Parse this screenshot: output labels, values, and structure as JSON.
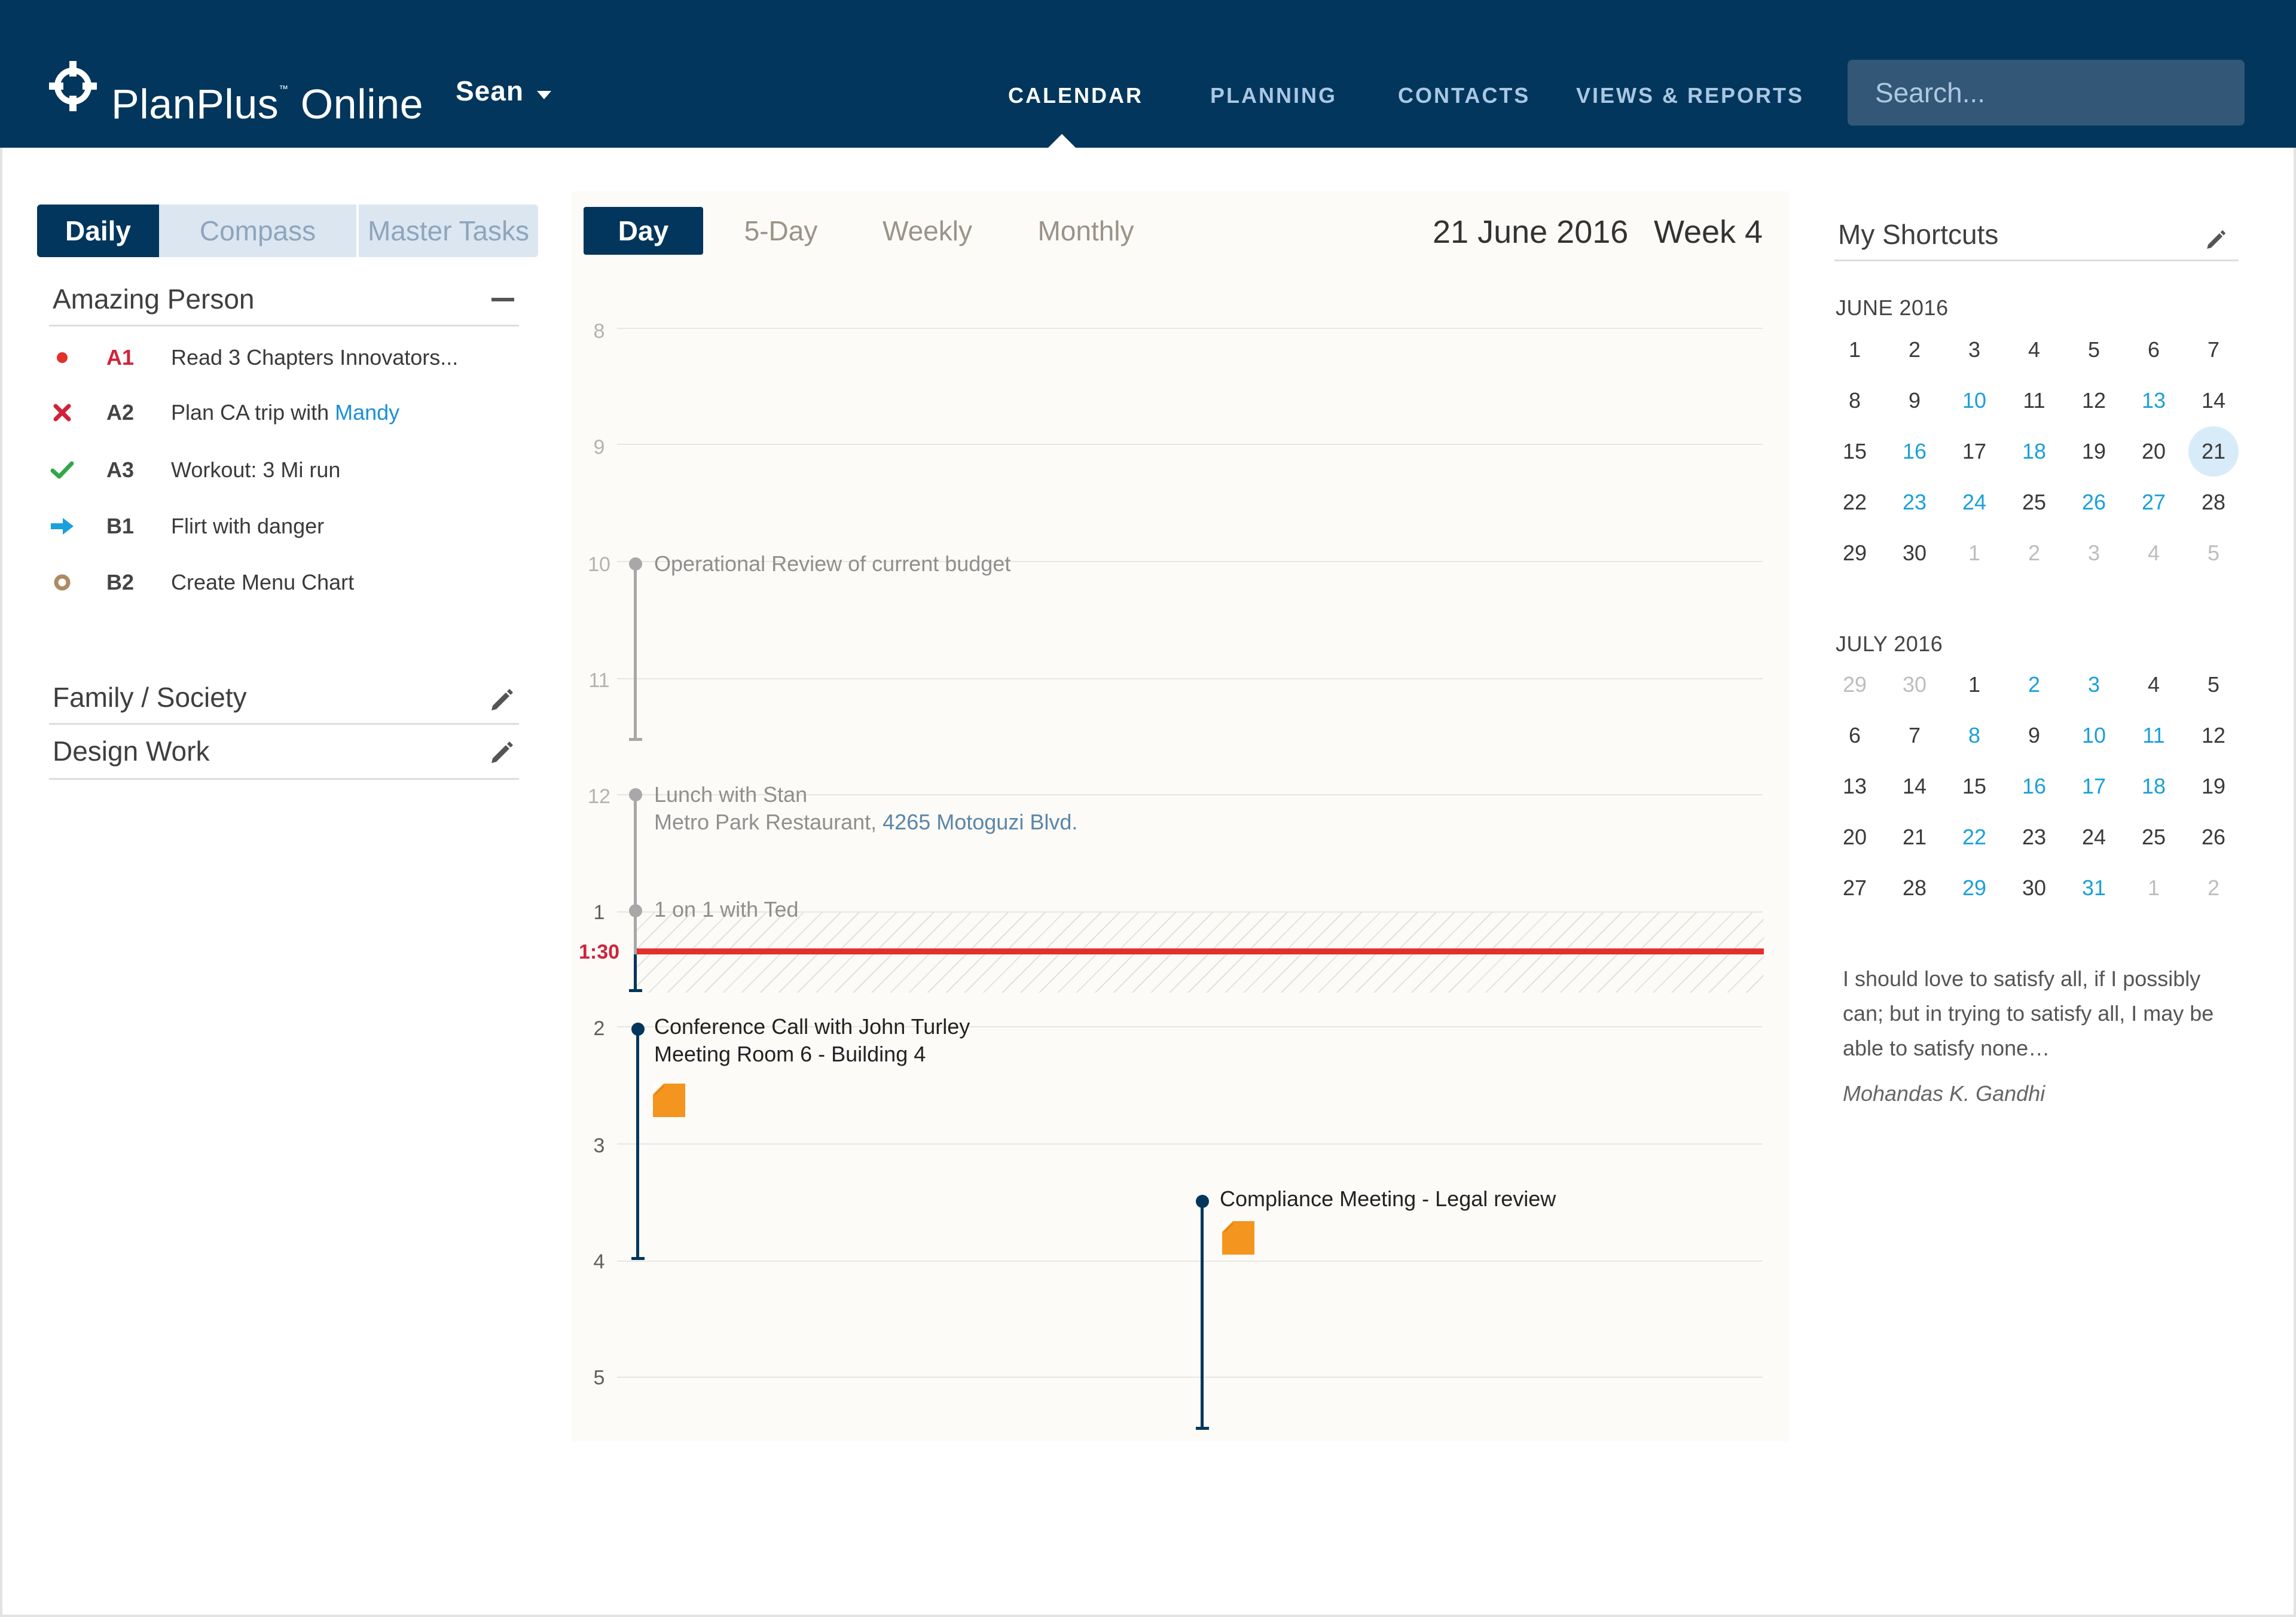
{
  "header": {
    "brand": "PlanPlus",
    "brand_tm": "™",
    "brand_suffix": "Online",
    "user": "Sean",
    "nav": {
      "calendar": "CALENDAR",
      "planning": "PLANNING",
      "contacts": "CONTACTS",
      "views_reports": "VIEWS & REPORTS"
    },
    "search_placeholder": "Search..."
  },
  "left_tabs": {
    "daily": "Daily",
    "compass": "Compass",
    "master_tasks": "Master Tasks"
  },
  "roles": {
    "amazing_person": "Amazing Person",
    "family_society": "Family / Society",
    "design_work": "Design Work"
  },
  "tasks": [
    {
      "status_icon": "red-dot-icon",
      "priority": "A1",
      "text": "Read 3 Chapters Innovators..."
    },
    {
      "status_icon": "x-mark-icon",
      "priority": "A2",
      "text": "Plan CA trip with ",
      "link": "Mandy"
    },
    {
      "status_icon": "checkmark-icon",
      "priority": "A3",
      "text": "Workout: 3 Mi run"
    },
    {
      "status_icon": "arrow-right-icon",
      "priority": "B1",
      "text": "Flirt with danger"
    },
    {
      "status_icon": "circle-icon",
      "priority": "B2",
      "text": "Create Menu Chart"
    }
  ],
  "calendar": {
    "tabs": {
      "day": "Day",
      "five_day": "5-Day",
      "weekly": "Weekly",
      "monthly": "Monthly"
    },
    "date": "21 June 2016",
    "week": "Week 4",
    "hours": {
      "h8": "8",
      "h9": "9",
      "h10": "10",
      "h11": "11",
      "h12": "12",
      "h1": "1",
      "h2": "2",
      "h3": "3",
      "h4": "4",
      "h5": "5"
    },
    "now": "1:30",
    "events": {
      "operational_review": "Operational Review of current budget",
      "lunch_title": "Lunch with Stan",
      "lunch_location_prefix": "Metro Park Restaurant, ",
      "lunch_address": "4265 Motoguzi Blvd.",
      "one_on_one": "1 on 1 with Ted",
      "conference_title": "Conference Call with John Turley",
      "conference_location": "Meeting Room 6 - Building 4",
      "compliance": "Compliance Meeting - Legal review"
    },
    "colors": {
      "past_event": "#a8a8a8",
      "upcoming_event": "#02365c",
      "now_line": "#e2312b",
      "note": "#f3951f"
    }
  },
  "shortcuts": {
    "title": "My Shortcuts",
    "june": {
      "label": "JUNE 2016",
      "days": [
        {
          "d": "1"
        },
        {
          "d": "2"
        },
        {
          "d": "3"
        },
        {
          "d": "4"
        },
        {
          "d": "5"
        },
        {
          "d": "6"
        },
        {
          "d": "7"
        },
        {
          "d": "8"
        },
        {
          "d": "9"
        },
        {
          "d": "10",
          "s": "link"
        },
        {
          "d": "11"
        },
        {
          "d": "12"
        },
        {
          "d": "13",
          "s": "link"
        },
        {
          "d": "14"
        },
        {
          "d": "15"
        },
        {
          "d": "16",
          "s": "link"
        },
        {
          "d": "17"
        },
        {
          "d": "18",
          "s": "link"
        },
        {
          "d": "19"
        },
        {
          "d": "20"
        },
        {
          "d": "21",
          "s": "today"
        },
        {
          "d": "22"
        },
        {
          "d": "23",
          "s": "link"
        },
        {
          "d": "24",
          "s": "link"
        },
        {
          "d": "25"
        },
        {
          "d": "26",
          "s": "link"
        },
        {
          "d": "27",
          "s": "link"
        },
        {
          "d": "28"
        },
        {
          "d": "29"
        },
        {
          "d": "30"
        },
        {
          "d": "1",
          "s": "muted"
        },
        {
          "d": "2",
          "s": "muted"
        },
        {
          "d": "3",
          "s": "muted"
        },
        {
          "d": "4",
          "s": "muted"
        },
        {
          "d": "5",
          "s": "muted"
        }
      ]
    },
    "july": {
      "label": "JULY 2016",
      "days": [
        {
          "d": "29",
          "s": "muted"
        },
        {
          "d": "30",
          "s": "muted"
        },
        {
          "d": "1"
        },
        {
          "d": "2",
          "s": "link"
        },
        {
          "d": "3",
          "s": "link"
        },
        {
          "d": "4"
        },
        {
          "d": "5"
        },
        {
          "d": "6"
        },
        {
          "d": "7"
        },
        {
          "d": "8",
          "s": "link"
        },
        {
          "d": "9"
        },
        {
          "d": "10",
          "s": "link"
        },
        {
          "d": "11",
          "s": "link"
        },
        {
          "d": "12"
        },
        {
          "d": "13"
        },
        {
          "d": "14"
        },
        {
          "d": "15"
        },
        {
          "d": "16",
          "s": "link"
        },
        {
          "d": "17",
          "s": "link"
        },
        {
          "d": "18",
          "s": "link"
        },
        {
          "d": "19"
        },
        {
          "d": "20"
        },
        {
          "d": "21"
        },
        {
          "d": "22",
          "s": "link"
        },
        {
          "d": "23"
        },
        {
          "d": "24"
        },
        {
          "d": "25"
        },
        {
          "d": "26"
        },
        {
          "d": "27"
        },
        {
          "d": "28"
        },
        {
          "d": "29",
          "s": "link"
        },
        {
          "d": "30"
        },
        {
          "d": "31",
          "s": "link"
        },
        {
          "d": "1",
          "s": "muted"
        },
        {
          "d": "2",
          "s": "muted"
        }
      ]
    }
  },
  "quote": {
    "text": "I should love to satisfy all, if I possibly can; but in trying to satisfy all, I may be able to satisfy none…",
    "author": "Mohandas K. Gandhi"
  }
}
